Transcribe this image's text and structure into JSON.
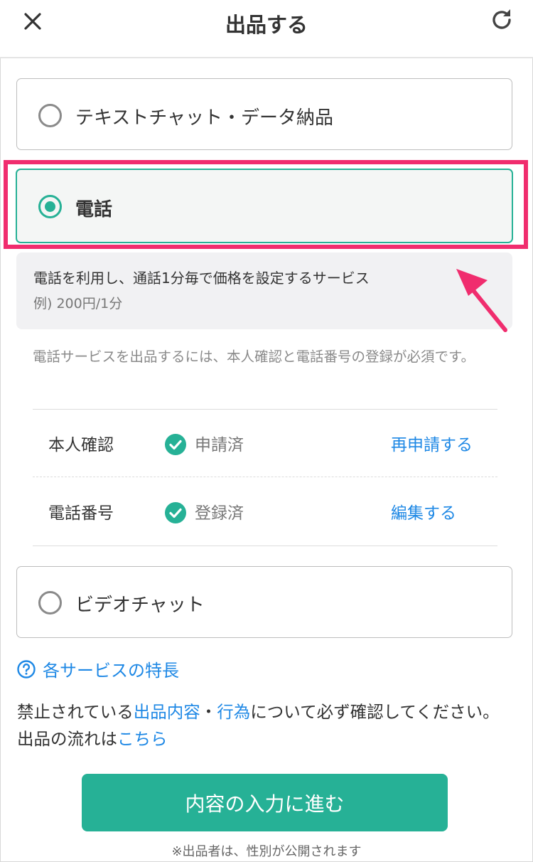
{
  "header": {
    "title": "出品する",
    "close_icon": "close-icon",
    "refresh_icon": "refresh-icon"
  },
  "options": {
    "text_chat": {
      "label": "テキストチャット・データ納品",
      "selected": false
    },
    "phone": {
      "label": "電話",
      "selected": true
    },
    "video_chat": {
      "label": "ビデオチャット",
      "selected": false
    }
  },
  "description": {
    "main": "電話を利用し、通話1分毎で価格を設定するサービス",
    "example": "例) 200円/1分"
  },
  "requirement_note": "電話サービスを出品するには、本人確認と電話番号の登録が必須です。",
  "verification": {
    "identity": {
      "label": "本人確認",
      "status": "申請済",
      "action": "再申請する"
    },
    "phone_number": {
      "label": "電話番号",
      "status": "登録済",
      "action": "編集する"
    }
  },
  "features_link": "各サービスの特長",
  "warning": {
    "prefix": "禁止されている",
    "link_content": "出品内容",
    "separator": "・",
    "link_act": "行為",
    "middle": "について必ず確認してください。出品の流れは",
    "link_here": "こちら"
  },
  "submit_label": "内容の入力に進む",
  "footnote": "※出品者は、性別が公開されます",
  "colors": {
    "accent": "#26b196",
    "link": "#1e88e5",
    "highlight": "#f02d6e"
  }
}
